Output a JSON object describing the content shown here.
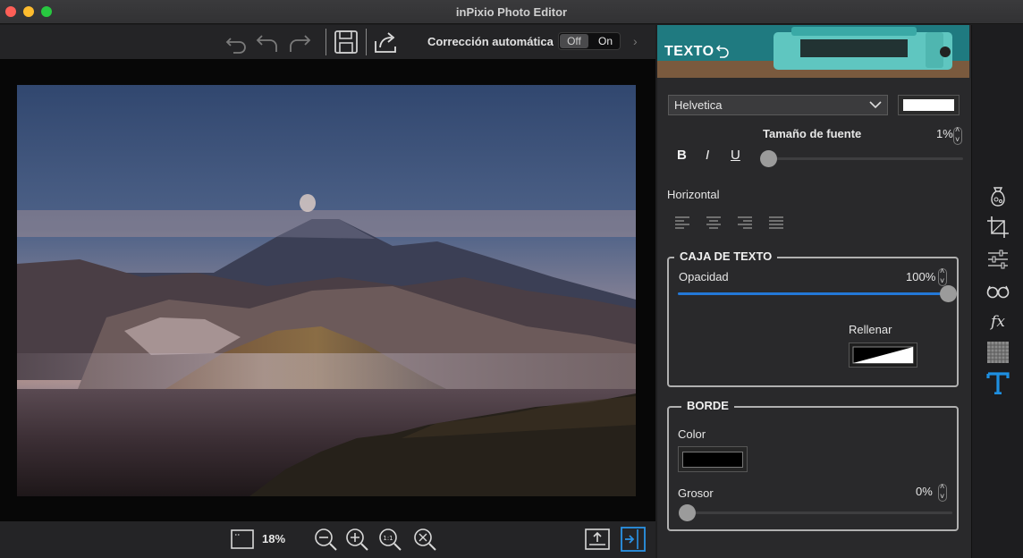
{
  "window": {
    "title": "inPixio Photo Editor"
  },
  "toolbar": {
    "icons": [
      "undo-all-icon",
      "undo-icon",
      "redo-icon",
      "save-icon",
      "share-icon"
    ],
    "auto_correction_label": "Corrección automática",
    "toggle_off": "Off",
    "toggle_on": "On",
    "toggle_state": "Off"
  },
  "bottom": {
    "zoom": "18%",
    "icons": [
      "fit-frame-icon",
      "zoom-out-icon",
      "zoom-in-icon",
      "zoom-1to1-icon",
      "zoom-fit-icon",
      "export-icon",
      "panel-toggle-icon"
    ]
  },
  "panel": {
    "title": "TEXTO",
    "font": {
      "family": "Helvetica",
      "color": "#ffffff",
      "size_label": "Tamaño de fuente",
      "size_value": "1%",
      "size_fraction": 0.0,
      "styles": [
        "B",
        "I",
        "U"
      ]
    },
    "horizontal_label": "Horizontal",
    "align_icons": [
      "align-left-icon",
      "align-center-icon",
      "align-right-icon",
      "align-justify-icon"
    ],
    "text_box": {
      "title": "CAJA DE TEXTO",
      "opacity_label": "Opacidad",
      "opacity_value": "100%",
      "opacity_fraction": 1.0,
      "fill_label": "Rellenar"
    },
    "border": {
      "title": "BORDE",
      "color_label": "Color",
      "color": "#000000",
      "thickness_label": "Grosor",
      "thickness_value": "0%",
      "thickness_fraction": 0.0
    }
  },
  "sidebar": {
    "items": [
      "bag-effects-icon",
      "crop-icon",
      "adjust-sliders-icon",
      "glasses-icon",
      "fx-icon",
      "texture-icon",
      "text-tool-icon"
    ],
    "active": "text-tool-icon",
    "accent": "#1e8fe0"
  }
}
